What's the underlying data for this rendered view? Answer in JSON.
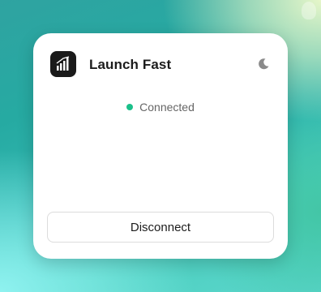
{
  "app": {
    "title": "Launch Fast",
    "logo_icon": "bar-chart-logo-icon",
    "theme_icon": "moon-icon"
  },
  "status": {
    "text": "Connected",
    "color": "#1bc08a"
  },
  "actions": {
    "disconnect_label": "Disconnect"
  }
}
